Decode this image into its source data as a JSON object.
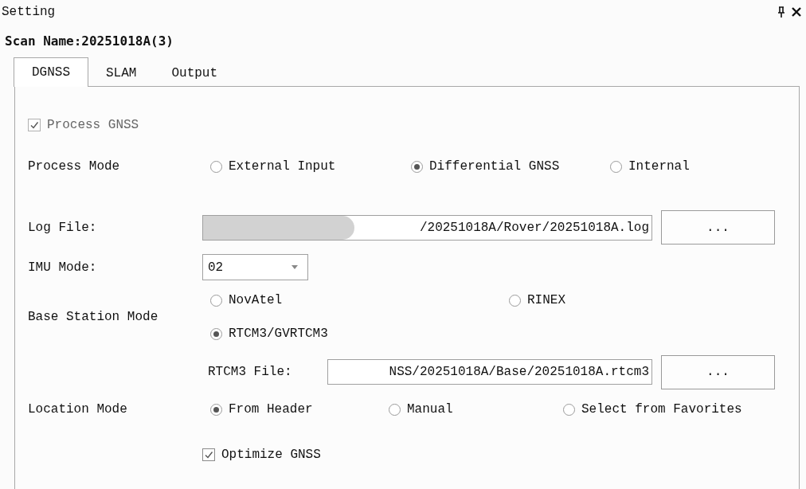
{
  "window": {
    "title": "Setting"
  },
  "scan_name": "Scan Name:20251018A(3)",
  "tabs": [
    {
      "label": "DGNSS",
      "selected": true
    },
    {
      "label": "SLAM",
      "selected": false
    },
    {
      "label": "Output",
      "selected": false
    }
  ],
  "rows": [
    {
      "kind": "checkbox",
      "label": "Process GNSS",
      "checked": true,
      "disabled": true
    },
    {
      "kind": "radio",
      "label": "Process Mode",
      "options": [
        {
          "label": "External Input",
          "selected": false
        },
        {
          "label": "Differential GNSS",
          "selected": true
        },
        {
          "label": "Internal",
          "selected": false
        }
      ]
    },
    {
      "kind": "file",
      "label": "Log File:",
      "value": "/20251018A/Rover/20251018A.log",
      "redacted": true,
      "button": "..."
    },
    {
      "kind": "combo",
      "label": "IMU Mode:",
      "value": "02"
    },
    {
      "kind": "radio",
      "label": "Base Station Mode",
      "options": [
        {
          "label": "NovAtel",
          "selected": false
        },
        {
          "label": "RINEX",
          "selected": false
        },
        {
          "label": "RTCM3/GVRTCM3",
          "selected": true
        }
      ]
    },
    {
      "kind": "file",
      "sublabel": "RTCM3 File:",
      "value": "NSS/20251018A/Base/20251018A.rtcm3",
      "button": "..."
    },
    {
      "kind": "radio",
      "label": "Location Mode",
      "options": [
        {
          "label": "From Header",
          "selected": true
        },
        {
          "label": "Manual",
          "selected": false
        },
        {
          "label": "Select from Favorites",
          "selected": false
        }
      ]
    },
    {
      "kind": "checkbox",
      "label": "Optimize GNSS",
      "checked": true,
      "disabled": false
    }
  ]
}
